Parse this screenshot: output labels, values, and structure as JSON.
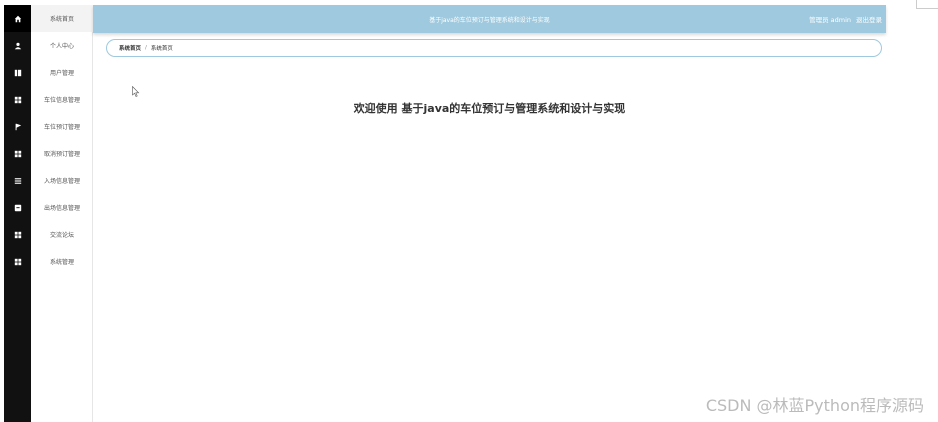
{
  "header": {
    "title": "基于java的车位预订与管理系统和设计与实现",
    "role_label": "管理员 admin",
    "logout_label": "退出登录"
  },
  "breadcrumb": {
    "home": "系统首页",
    "separator": "/",
    "current": "系统首页"
  },
  "sidebar": {
    "items": [
      {
        "label": "系统首页",
        "icon": "home-icon"
      },
      {
        "label": "个人中心",
        "icon": "user-icon"
      },
      {
        "label": "用户管理",
        "icon": "book-icon"
      },
      {
        "label": "车位信息管理",
        "icon": "grid-icon"
      },
      {
        "label": "车位预订管理",
        "icon": "flag-icon"
      },
      {
        "label": "取消预订管理",
        "icon": "grid-icon"
      },
      {
        "label": "入场信息管理",
        "icon": "list-icon"
      },
      {
        "label": "出场信息管理",
        "icon": "inbox-icon"
      },
      {
        "label": "交流论坛",
        "icon": "grid-icon"
      },
      {
        "label": "系统管理",
        "icon": "grid-icon"
      }
    ]
  },
  "main": {
    "welcome": "欢迎使用 基于java的车位预订与管理系统和设计与实现"
  },
  "watermark": "CSDN @林蓝Python程序源码",
  "colors": {
    "header": "#9fc9de",
    "rail": "#111111"
  }
}
